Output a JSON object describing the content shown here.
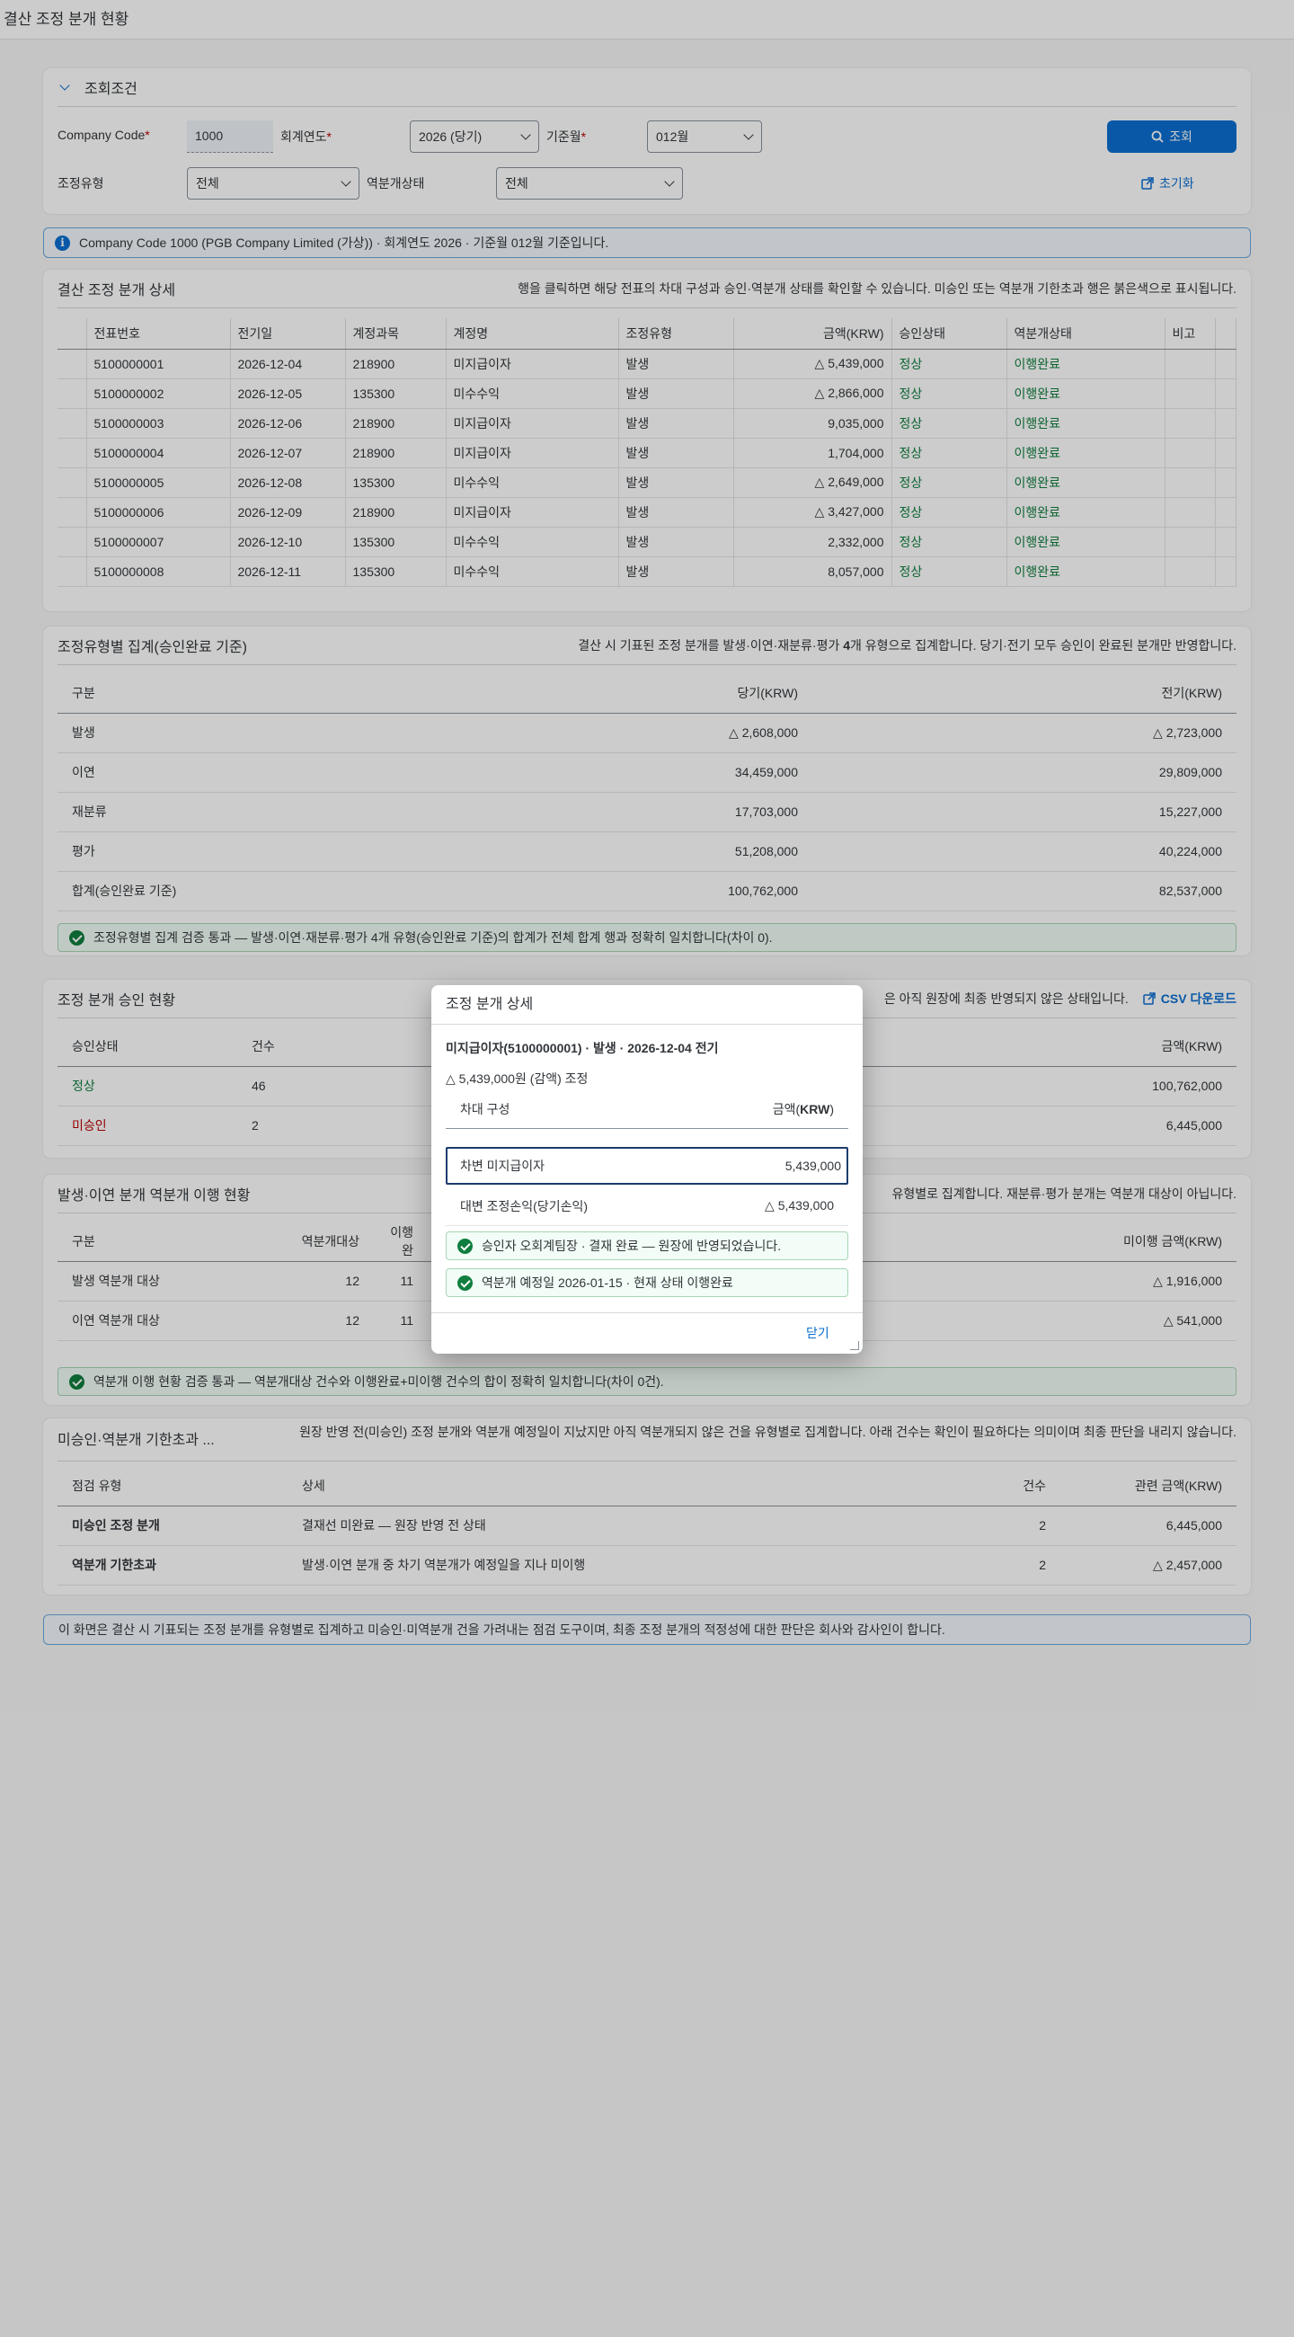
{
  "page": {
    "title": "결산 조정 분개 현황"
  },
  "filter": {
    "title": "조회조건",
    "company_label": "Company Code",
    "company_value": "1000",
    "year_label": "회계연도",
    "year_value": "2026 (당기)",
    "month_label": "기준월",
    "month_value": "012월",
    "type_label": "조정유형",
    "type_value": "전체",
    "rev_label": "역분개상태",
    "rev_value": "전체",
    "search_label": "조회",
    "reset_label": "초기화"
  },
  "info_msg": "Company Code 1000 (PGB Company Limited (가상)) · 회계연도 2026 · 기준월 012월 기준입니다.",
  "detail": {
    "title": "결산 조정 분개 상세",
    "desc": "행을 클릭하면 해당 전표의 차대 구성과 승인·역분개 상태를 확인할 수 있습니다. 미승인 또는 역분개 기한초과 행은 붉은색으로 표시됩니다.",
    "columns": [
      "전표번호",
      "전기일",
      "계정과목",
      "계정명",
      "조정유형",
      "금액(KRW)",
      "승인상태",
      "역분개상태",
      "비고"
    ],
    "rows": [
      [
        "5100000001",
        "2026-12-04",
        "218900",
        "미지급이자",
        "발생",
        "△ 5,439,000",
        "정상",
        "이행완료",
        ""
      ],
      [
        "5100000002",
        "2026-12-05",
        "135300",
        "미수수익",
        "발생",
        "△ 2,866,000",
        "정상",
        "이행완료",
        ""
      ],
      [
        "5100000003",
        "2026-12-06",
        "218900",
        "미지급이자",
        "발생",
        "9,035,000",
        "정상",
        "이행완료",
        ""
      ],
      [
        "5100000004",
        "2026-12-07",
        "218900",
        "미지급이자",
        "발생",
        "1,704,000",
        "정상",
        "이행완료",
        ""
      ],
      [
        "5100000005",
        "2026-12-08",
        "135300",
        "미수수익",
        "발생",
        "△ 2,649,000",
        "정상",
        "이행완료",
        ""
      ],
      [
        "5100000006",
        "2026-12-09",
        "218900",
        "미지급이자",
        "발생",
        "△ 3,427,000",
        "정상",
        "이행완료",
        ""
      ],
      [
        "5100000007",
        "2026-12-10",
        "135300",
        "미수수익",
        "발생",
        "2,332,000",
        "정상",
        "이행완료",
        ""
      ],
      [
        "5100000008",
        "2026-12-11",
        "135300",
        "미수수익",
        "발생",
        "8,057,000",
        "정상",
        "이행완료",
        ""
      ]
    ]
  },
  "bytype": {
    "title": "조정유형별 집계(승인완료 기준)",
    "desc_pre": "결산 시 기표된 조정 분개를 발생·이연·재분류·평가 ",
    "desc_bold": "4",
    "desc_post": "개 유형으로 집계합니다. 당기·전기 모두 승인이 완료된 분개만 반영합니다.",
    "columns": [
      "구분",
      "당기(KRW)",
      "전기(KRW)"
    ],
    "rows": [
      [
        "발생",
        "△ 2,608,000",
        "△ 2,723,000"
      ],
      [
        "이연",
        "34,459,000",
        "29,809,000"
      ],
      [
        "재분류",
        "17,703,000",
        "15,227,000"
      ],
      [
        "평가",
        "51,208,000",
        "40,224,000"
      ],
      [
        "합계(승인완료 기준)",
        "100,762,000",
        "82,537,000"
      ]
    ],
    "ok": "조정유형별 집계 검증 통과 — 발생·이연·재분류·평가 4개 유형(승인완료 기준)의 합계가 전체 합계 행과 정확히 일치합니다(차이 0)."
  },
  "approval": {
    "title": "조정 분개 승인 현황",
    "desc": "은 아직 원장에 최종 반영되지 않은 상태입니다.",
    "csv_label": "CSV 다운로드",
    "columns": [
      "승인상태",
      "건수",
      "금액(KRW)"
    ],
    "rows": [
      [
        "정상",
        "46",
        "100,762,000"
      ],
      [
        "미승인",
        "2",
        "6,445,000"
      ]
    ]
  },
  "reversal": {
    "title": "발생·이연 분개 역분개 이행 현황",
    "desc": "유형별로 집계합니다. 재분류·평가 분개는 역분개 대상이 아닙니다.",
    "columns": [
      "구분",
      "역분개대상",
      "이행완",
      "미이행 금액(KRW)"
    ],
    "rows": [
      [
        "발생 역분개 대상",
        "12",
        "11",
        "△ 1,916,000"
      ],
      [
        "이연 역분개 대상",
        "12",
        "11",
        "△ 541,000"
      ]
    ],
    "ok": "역분개 이행 현황 검증 통과 — 역분개대상 건수와 이행완료+미이행 건수의 합이 정확히 일치합니다(차이 0건)."
  },
  "exceptions": {
    "title": "미승인·역분개 기한초과 ...",
    "desc": "원장 반영 전(미승인) 조정 분개와 역분개 예정일이 지났지만 아직 역분개되지 않은 건을 유형별로 집계합니다. 아래 건수는 확인이 필요하다는 의미이며 최종 판단을 내리지 않습니다.",
    "columns": [
      "점검 유형",
      "상세",
      "건수",
      "관련 금액(KRW)"
    ],
    "rows": [
      [
        "미승인 조정 분개",
        "결재선 미완료 — 원장 반영 전 상태",
        "2",
        "6,445,000"
      ],
      [
        "역분개 기한초과",
        "발생·이연 분개 중 차기 역분개가 예정일을 지나 미이행",
        "2",
        "△ 2,457,000"
      ]
    ]
  },
  "footer_msg": "이 화면은 결산 시 기표되는 조정 분개를 유형별로 집계하고 미승인·미역분개 건을 가려내는 점검 도구이며, 최종 조정 분개의 적정성에 대한 판단은 회사와 감사인이 합니다.",
  "dialog": {
    "title": "조정 분개 상세",
    "subtitle": "미지급이자(5100000001) · 발생 · 2026-12-04 전기",
    "amount_note": "△ 5,439,000원 (감액) 조정",
    "col_comp": "차대 구성",
    "col_amt_pre": "금액(",
    "col_amt_bold": "KRW",
    "col_amt_post": ")",
    "debit_label": "차변 미지급이자",
    "debit_amt": "5,439,000",
    "credit_label": "대변 조정손익(당기손익)",
    "credit_amt": "△ 5,439,000",
    "ok1": "승인자 오회계팀장 · 결재 완료 — 원장에 반영되었습니다.",
    "ok2": "역분개 예정일 2026-01-15 · 현재 상태 이행완료",
    "close_label": "닫기"
  }
}
